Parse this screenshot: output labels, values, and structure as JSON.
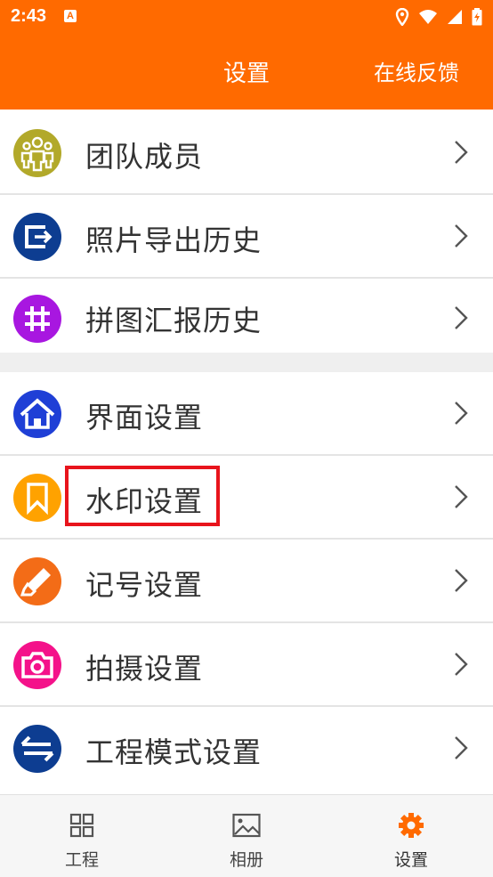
{
  "status": {
    "time": "2:43",
    "app_badge": "A"
  },
  "header": {
    "title": "设置",
    "feedback": "在线反馈"
  },
  "rows": [
    {
      "label": "团队成员",
      "icon": "team-members-icon",
      "color": "#B2A92A"
    },
    {
      "label": "照片导出历史",
      "icon": "photo-export-icon",
      "color": "#0D3D91"
    },
    {
      "label": "拼图汇报历史",
      "icon": "grid-hash-icon",
      "color": "#A817E0"
    },
    {
      "label": "界面设置",
      "icon": "home-icon",
      "color": "#1F3FD6"
    },
    {
      "label": "水印设置",
      "icon": "bookmark-icon",
      "color": "#FFA200"
    },
    {
      "label": "记号设置",
      "icon": "marker-icon",
      "color": "#F36C17"
    },
    {
      "label": "拍摄设置",
      "icon": "camera-icon",
      "color": "#F4128A"
    },
    {
      "label": "工程模式设置",
      "icon": "swap-arrows-icon",
      "color": "#0D3D91"
    }
  ],
  "bottom_nav": [
    {
      "label": "工程",
      "icon": "grid-icon"
    },
    {
      "label": "相册",
      "icon": "image-icon"
    },
    {
      "label": "设置",
      "icon": "gear-icon",
      "active": true
    }
  ],
  "colors": {
    "accent": "#FF6A00",
    "highlight": "#E8141C"
  }
}
